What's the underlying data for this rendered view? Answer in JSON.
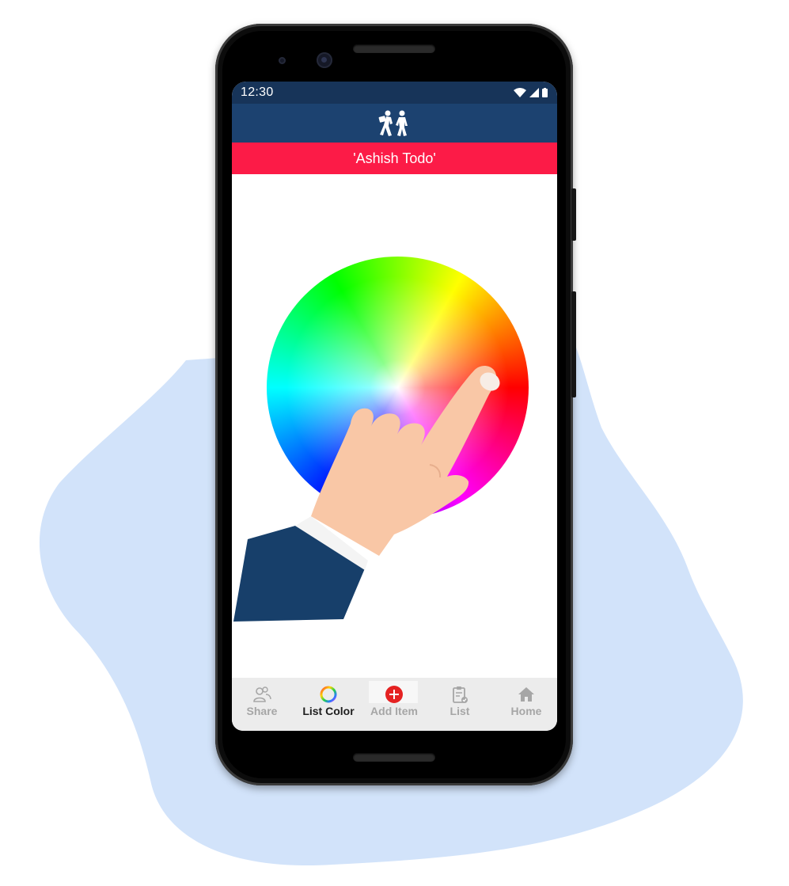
{
  "status_bar": {
    "time": "12:30"
  },
  "header": {
    "logo_icon": "people-walking-icon"
  },
  "title_bar": {
    "title": "'Ashish Todo'"
  },
  "content": {
    "illustration": "hand-pointing-color-wheel"
  },
  "bottom_nav": {
    "items": [
      {
        "label": "Share",
        "icon": "people-icon",
        "active": false
      },
      {
        "label": "List Color",
        "icon": "color-ring-icon",
        "active": true
      },
      {
        "label": "Add Item",
        "icon": "plus-circle-icon",
        "active": false
      },
      {
        "label": "List",
        "icon": "clipboard-check-icon",
        "active": false
      },
      {
        "label": "Home",
        "icon": "home-icon",
        "active": false
      }
    ]
  },
  "colors": {
    "status_bar": "#173459",
    "header": "#1c4270",
    "title_bar": "#fc1b47",
    "nav_bg": "#ececec",
    "add_button": "#e52222",
    "backdrop_blob": "#d2e3fa"
  }
}
